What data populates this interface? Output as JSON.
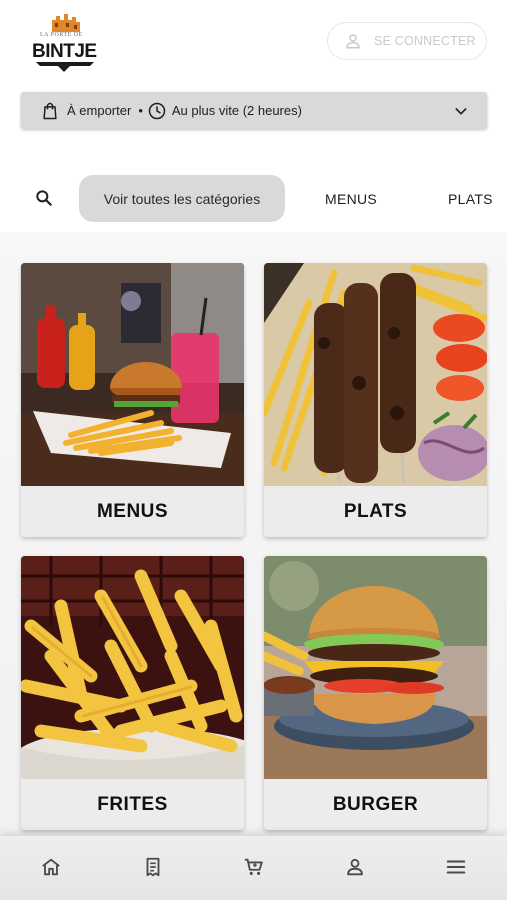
{
  "header": {
    "logo_tag": "LA PORTE DE",
    "logo_name": "BINTJE",
    "login_label": "SE CONNECTER"
  },
  "order": {
    "mode_label": "À emporter",
    "separator": "•",
    "time_label": "Au plus vite (2 heures)"
  },
  "categories": {
    "all_label": "Voir toutes les catégories",
    "tabs": [
      "MENUS",
      "PLATS"
    ]
  },
  "products": [
    {
      "title": "MENUS"
    },
    {
      "title": "PLATS"
    },
    {
      "title": "FRITES"
    },
    {
      "title": "BURGER"
    }
  ],
  "bottom_nav": {
    "icons": [
      "home-icon",
      "receipt-icon",
      "cart-icon",
      "user-icon",
      "menu-icon"
    ]
  }
}
